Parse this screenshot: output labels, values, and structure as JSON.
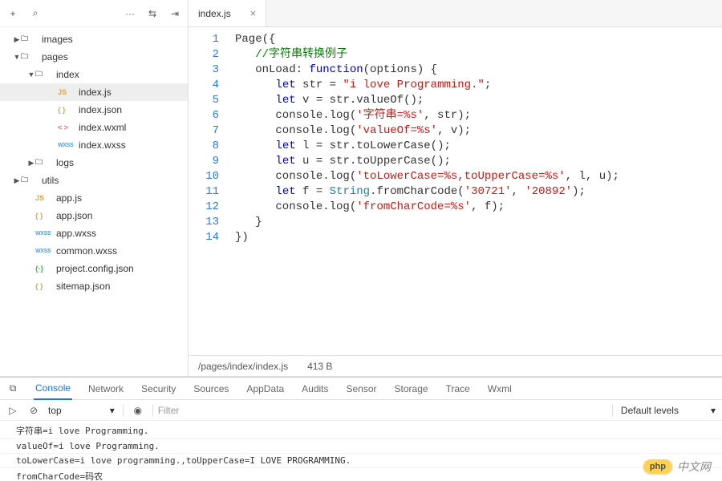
{
  "sidebar": {
    "items": [
      {
        "label": "images",
        "type": "folder",
        "open": false,
        "indent": 16
      },
      {
        "label": "pages",
        "type": "folder",
        "open": true,
        "indent": 16
      },
      {
        "label": "index",
        "type": "folder",
        "open": true,
        "indent": 34
      },
      {
        "label": "index.js",
        "type": "js",
        "indent": 62,
        "selected": true
      },
      {
        "label": "index.json",
        "type": "json",
        "indent": 62
      },
      {
        "label": "index.wxml",
        "type": "wxml",
        "indent": 62
      },
      {
        "label": "index.wxss",
        "type": "wxss",
        "indent": 62
      },
      {
        "label": "logs",
        "type": "folder",
        "open": false,
        "indent": 34
      },
      {
        "label": "utils",
        "type": "folder",
        "open": false,
        "indent": 16
      },
      {
        "label": "app.js",
        "type": "js",
        "indent": 34
      },
      {
        "label": "app.json",
        "type": "json",
        "indent": 34
      },
      {
        "label": "app.wxss",
        "type": "wxss",
        "indent": 34
      },
      {
        "label": "common.wxss",
        "type": "wxss",
        "indent": 34
      },
      {
        "label": "project.config.json",
        "type": "config",
        "indent": 34
      },
      {
        "label": "sitemap.json",
        "type": "json",
        "indent": 34
      }
    ]
  },
  "editor": {
    "tab_label": "index.js",
    "status_path": "/pages/index/index.js",
    "status_size": "413 B",
    "lines": [
      [
        [
          "pl",
          "Page({"
        ]
      ],
      [
        [
          "pl",
          "   "
        ],
        [
          "cmt",
          "//字符串转换例子"
        ]
      ],
      [
        [
          "pl",
          "   onLoad: "
        ],
        [
          "kw",
          "function"
        ],
        [
          "pl",
          "(options) {"
        ]
      ],
      [
        [
          "pl",
          "      "
        ],
        [
          "kw",
          "let"
        ],
        [
          "pl",
          " str = "
        ],
        [
          "str",
          "\"i love Programming.\""
        ],
        [
          "pl",
          ";"
        ]
      ],
      [
        [
          "pl",
          "      "
        ],
        [
          "kw",
          "let"
        ],
        [
          "pl",
          " v = str.valueOf();"
        ]
      ],
      [
        [
          "pl",
          "      console.log("
        ],
        [
          "str",
          "'字符串=%s'"
        ],
        [
          "pl",
          ", str);"
        ]
      ],
      [
        [
          "pl",
          "      console.log("
        ],
        [
          "str",
          "'valueOf=%s'"
        ],
        [
          "pl",
          ", v);"
        ]
      ],
      [
        [
          "pl",
          "      "
        ],
        [
          "kw",
          "let"
        ],
        [
          "pl",
          " l = str.toLowerCase();"
        ]
      ],
      [
        [
          "pl",
          "      "
        ],
        [
          "kw",
          "let"
        ],
        [
          "pl",
          " u = str.toUpperCase();"
        ]
      ],
      [
        [
          "pl",
          "      console.log("
        ],
        [
          "str",
          "'toLowerCase=%s,toUpperCase=%s'"
        ],
        [
          "pl",
          ", l, u);"
        ]
      ],
      [
        [
          "pl",
          "      "
        ],
        [
          "kw",
          "let"
        ],
        [
          "pl",
          " f = "
        ],
        [
          "fn",
          "String"
        ],
        [
          "pl",
          ".fromCharCode("
        ],
        [
          "str",
          "'30721'"
        ],
        [
          "pl",
          ", "
        ],
        [
          "str",
          "'20892'"
        ],
        [
          "pl",
          ");"
        ]
      ],
      [
        [
          "pl",
          "      console.log("
        ],
        [
          "str",
          "'fromCharCode=%s'"
        ],
        [
          "pl",
          ", f);"
        ]
      ],
      [
        [
          "pl",
          "   }"
        ]
      ],
      [
        [
          "pl",
          "})"
        ]
      ]
    ]
  },
  "devtools": {
    "tabs": [
      "Console",
      "Network",
      "Security",
      "Sources",
      "AppData",
      "Audits",
      "Sensor",
      "Storage",
      "Trace",
      "Wxml"
    ],
    "active_tab": "Console",
    "context": "top",
    "filter_placeholder": "Filter",
    "levels": "Default levels",
    "console_lines": [
      "字符串=i love Programming.",
      "valueOf=i love Programming.",
      "toLowerCase=i love programming.,toUpperCase=I LOVE PROGRAMMING.",
      "fromCharCode=码农"
    ]
  },
  "watermark": {
    "badge": "php",
    "text": "中文网"
  },
  "icons": {
    "plus": "+",
    "search": "⌕",
    "more": "···",
    "settings": "⇆",
    "collapse": "⇥",
    "chevron_right": "▶",
    "chevron_down": "▼",
    "inspect": "⧉",
    "stop": "⊘",
    "eye": "◉",
    "play": "▷"
  }
}
